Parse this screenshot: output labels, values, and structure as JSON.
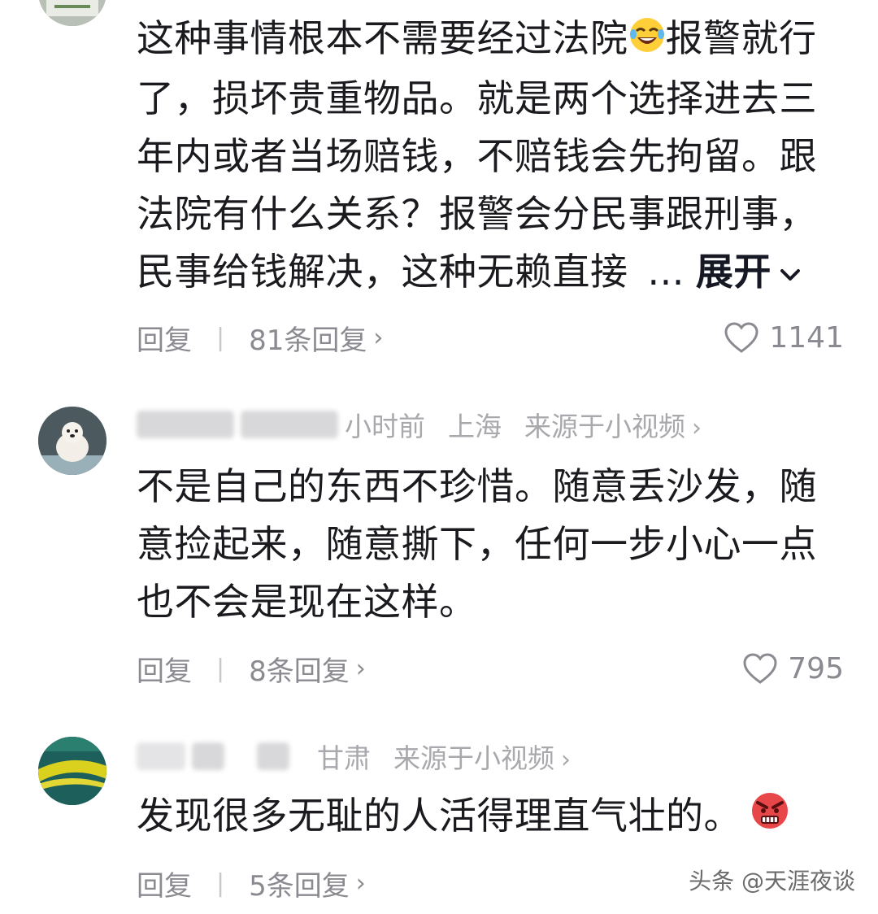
{
  "comments": [
    {
      "lines": [
        "这种事情根本不需要经过法院",
        "了，损坏贵重物品。就是两个选择进去三",
        "年内或者当场赔钱，不赔钱会先拘留。跟",
        "法院有什么关系？报警会分民事跟刑事，",
        "民事给钱解决，这种无赖直接"
      ],
      "line1_tail": "报警就行",
      "ellipsis": "...",
      "expand_label": "展开",
      "reply_label": "回复",
      "replies_label": "81条回复",
      "likes": "1141"
    },
    {
      "time": "小时前",
      "location": "上海",
      "source": "来源于小视频",
      "lines": [
        "不是自己的东西不珍惜。随意丢沙发，随",
        "意捡起来，随意撕下，任何一步小心一点",
        "也不会是现在这样。"
      ],
      "reply_label": "回复",
      "replies_label": "8条回复",
      "likes": "795"
    },
    {
      "location": "甘肃",
      "source": "来源于小视频",
      "lines": [
        "发现很多无耻的人活得理直气壮的。"
      ],
      "reply_label": "回复",
      "replies_label": "5条回复"
    }
  ],
  "watermark": "头条 @天涯夜谈",
  "colors": {
    "text": "#1a1a1f",
    "meta": "#a8a8ad",
    "action": "#8a8a90"
  }
}
